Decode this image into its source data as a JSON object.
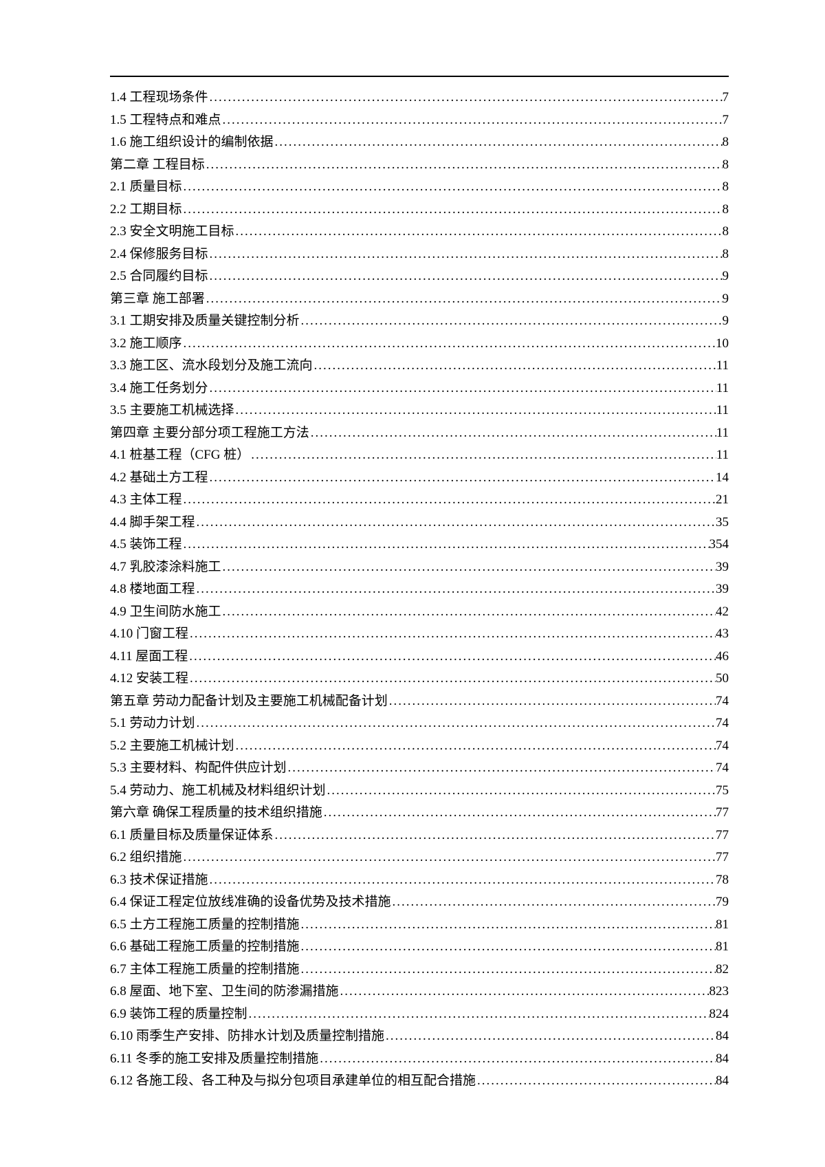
{
  "toc": [
    {
      "label": "1.4 工程现场条件",
      "page": "7"
    },
    {
      "label": "1.5 工程特点和难点",
      "page": "7"
    },
    {
      "label": "1.6 施工组织设计的编制依据",
      "page": "8"
    },
    {
      "label": "第二章 工程目标",
      "page": "8"
    },
    {
      "label": "2.1 质量目标",
      "page": "8"
    },
    {
      "label": "2.2 工期目标",
      "page": "8"
    },
    {
      "label": "2.3 安全文明施工目标",
      "page": "8"
    },
    {
      "label": "2.4 保修服务目标",
      "page": "8"
    },
    {
      "label": "2.5 合同履约目标",
      "page": "9"
    },
    {
      "label": "第三章  施工部署",
      "page": "9"
    },
    {
      "label": "3.1 工期安排及质量关键控制分析",
      "page": "9"
    },
    {
      "label": "3.2 施工顺序",
      "page": "10"
    },
    {
      "label": "3.3 施工区、流水段划分及施工流向",
      "page": "11"
    },
    {
      "label": "3.4 施工任务划分",
      "page": "11"
    },
    {
      "label": "3.5 主要施工机械选择",
      "page": "11"
    },
    {
      "label": "第四章 主要分部分项工程施工方法",
      "page": "11"
    },
    {
      "label": "4.1 桩基工程（CFG 桩）",
      "page": "11"
    },
    {
      "label": "4.2 基础土方工程",
      "page": "14"
    },
    {
      "label": "4.3 主体工程",
      "page": "21"
    },
    {
      "label": "4.4 脚手架工程",
      "page": "35"
    },
    {
      "label": "4.5 装饰工程",
      "page": "354"
    },
    {
      "label": "4.7 乳胶漆涂料施工",
      "page": "39"
    },
    {
      "label": "4.8 楼地面工程",
      "page": "39"
    },
    {
      "label": "4.9 卫生间防水施工",
      "page": "42"
    },
    {
      "label": "4.10 门窗工程",
      "page": "43"
    },
    {
      "label": "4.11 屋面工程",
      "page": "46"
    },
    {
      "label": "4.12 安装工程",
      "page": "50"
    },
    {
      "label": "第五章  劳动力配备计划及主要施工机械配备计划",
      "page": "74"
    },
    {
      "label": "5.1 劳动力计划",
      "page": " 74"
    },
    {
      "label": "5.2 主要施工机械计划",
      "page": "74"
    },
    {
      "label": "5.3 主要材料、构配件供应计划",
      "page": "74"
    },
    {
      "label": "5.4 劳动力、施工机械及材料组织计划",
      "page": "75"
    },
    {
      "label": "第六章  确保工程质量的技术组织措施",
      "page": "77"
    },
    {
      "label": "6.1 质量目标及质量保证体系",
      "page": "77"
    },
    {
      "label": "6.2 组织措施",
      "page": "77"
    },
    {
      "label": "6.3 技术保证措施",
      "page": "78"
    },
    {
      "label": "6.4 保证工程定位放线准确的设备优势及技术措施",
      "page": "79"
    },
    {
      "label": "6.5 土方工程施工质量的控制措施",
      "page": "81"
    },
    {
      "label": "6.6 基础工程施工质量的控制措施",
      "page": "81"
    },
    {
      "label": "6.7 主体工程施工质量的控制措施",
      "page": "82"
    },
    {
      "label": "6.8 屋面、地下室、卫生间的防渗漏措施",
      "page": "823"
    },
    {
      "label": "6.9 装饰工程的质量控制",
      "page": "824"
    },
    {
      "label": "6.10 雨季生产安排、防排水计划及质量控制措施",
      "page": "84"
    },
    {
      "label": "6.11 冬季的施工安排及质量控制措施",
      "page": "84"
    },
    {
      "label": "6.12 各施工段、各工种及与拟分包项目承建单位的相互配合措施",
      "page": "84"
    }
  ]
}
